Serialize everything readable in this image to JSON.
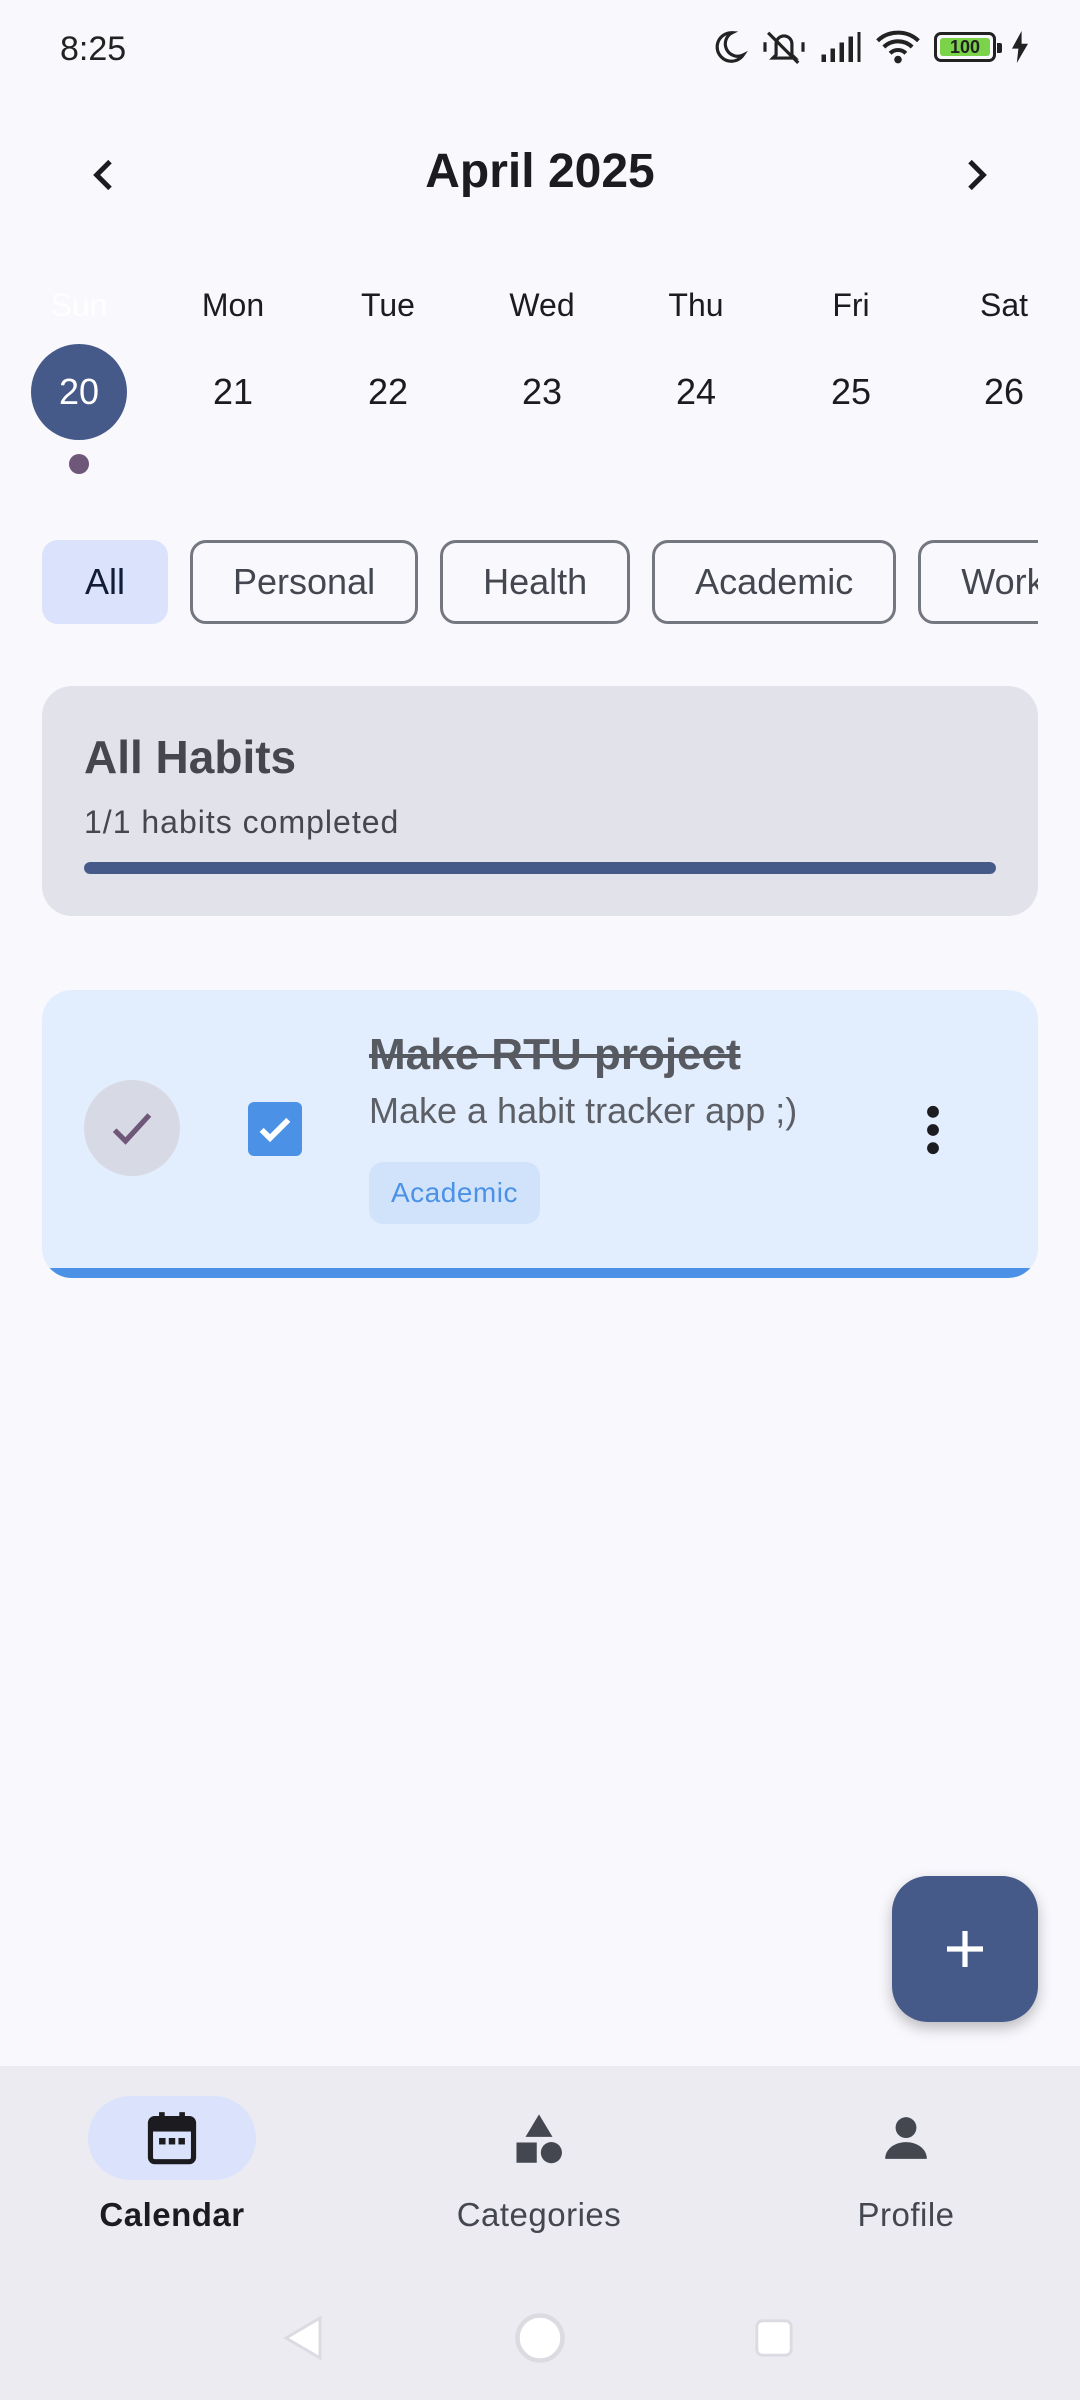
{
  "status_bar": {
    "time": "8:25",
    "battery": "100",
    "icons": [
      "moon-icon",
      "silent-icon",
      "signal-icon",
      "wifi-icon",
      "battery-icon",
      "charging-icon"
    ]
  },
  "calendar": {
    "month_title": "April 2025",
    "days": [
      {
        "name": "Sun",
        "num": "20",
        "selected": true,
        "has_dot": true
      },
      {
        "name": "Mon",
        "num": "21"
      },
      {
        "name": "Tue",
        "num": "22"
      },
      {
        "name": "Wed",
        "num": "23"
      },
      {
        "name": "Thu",
        "num": "24"
      },
      {
        "name": "Fri",
        "num": "25"
      },
      {
        "name": "Sat",
        "num": "26"
      }
    ]
  },
  "filters": {
    "chips": [
      "All",
      "Personal",
      "Health",
      "Academic",
      "Work"
    ],
    "active": "All"
  },
  "summary": {
    "title": "All Habits",
    "subtitle": "1/1 habits completed",
    "progress": 1.0
  },
  "habits": [
    {
      "title": "Make RTU project",
      "description": "Make a habit tracker app ;)",
      "tag": "Academic",
      "completed": true
    }
  ],
  "bottom_nav": {
    "items": [
      {
        "label": "Calendar",
        "icon": "calendar-icon",
        "active": true
      },
      {
        "label": "Categories",
        "icon": "categories-icon"
      },
      {
        "label": "Profile",
        "icon": "profile-icon"
      }
    ]
  },
  "colors": {
    "primary": "#465a89",
    "accent_blue": "#4b92e6",
    "chip_active": "#dbe2fb",
    "habit_card_bg": "#e2eefe",
    "summary_bg": "#e1e2ea"
  }
}
